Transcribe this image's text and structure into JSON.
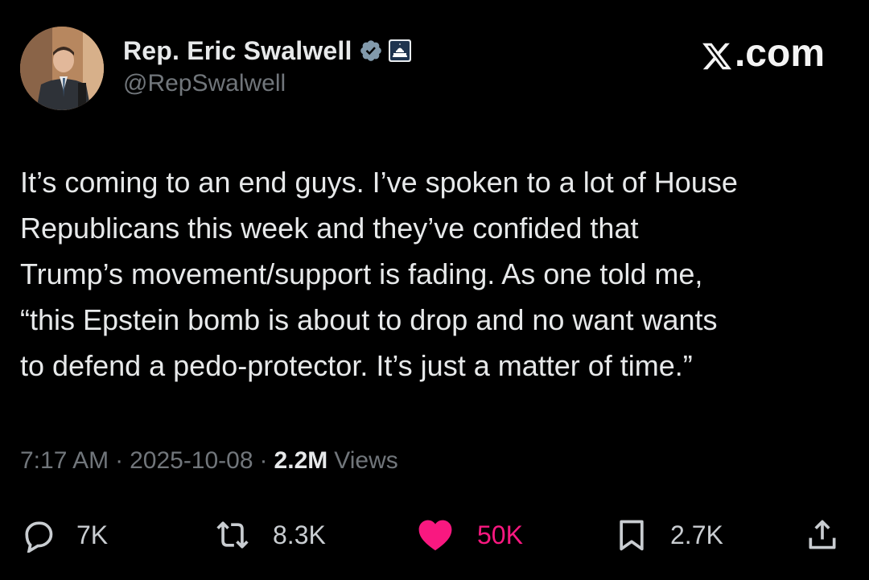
{
  "author": {
    "display_name": "Rep. Eric Swalwell",
    "handle": "@RepSwalwell",
    "verified_icon": "verified-badge-icon",
    "affiliation_icon": "us-capitol-icon"
  },
  "brand": {
    "logo_icon": "x-logo-icon",
    "suffix": ".com"
  },
  "tweet": {
    "text": "It’s coming to an end guys. I’ve spoken to a lot of House\nRepublicans this week and they’ve confided that\nTrump’s movement/support is fading. As one told me,\n“this Epstein bomb is about to drop and no want wants\nto defend a pedo-protector. It’s just a matter of time.”",
    "time": "7:17 AM",
    "date": "2025-10-08",
    "separator": "·",
    "views_count": "2.2M",
    "views_label": "Views"
  },
  "actions": {
    "reply": {
      "icon": "reply-icon",
      "count": "7K"
    },
    "repost": {
      "icon": "repost-icon",
      "count": "8.3K"
    },
    "like": {
      "icon": "heart-icon",
      "count": "50K",
      "color": "#f91880"
    },
    "bookmark": {
      "icon": "bookmark-icon",
      "count": "2.7K"
    },
    "share": {
      "icon": "share-icon"
    }
  },
  "colors": {
    "background": "#000000",
    "primary_text": "#e7e9ea",
    "secondary_text": "#71767b",
    "verified": "#829aab",
    "like": "#f91880"
  }
}
